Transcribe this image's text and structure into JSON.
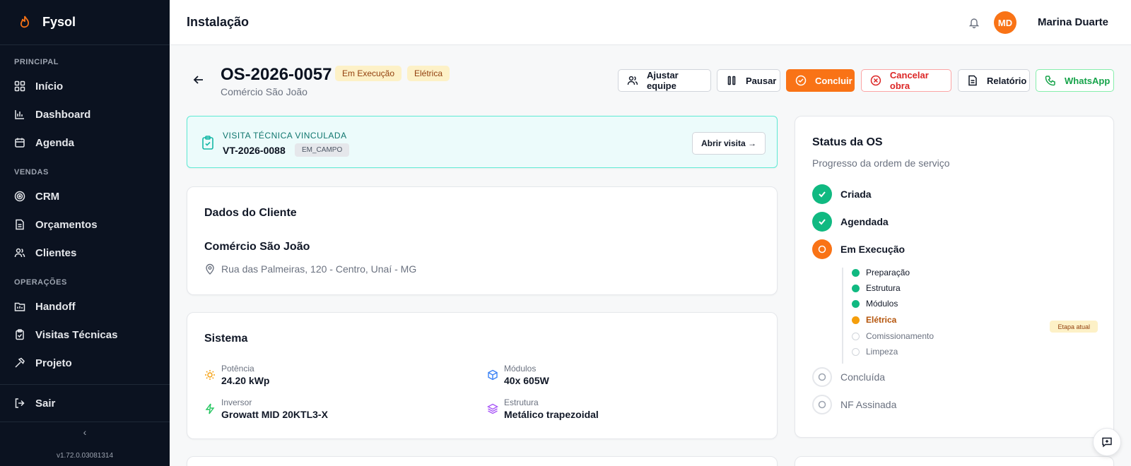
{
  "app": {
    "name": "Fysol",
    "version": "v1.72.0.03081314"
  },
  "sidebar": {
    "sections": [
      {
        "label": "PRINCIPAL",
        "items": [
          {
            "label": "Início",
            "icon": "grid-icon"
          },
          {
            "label": "Dashboard",
            "icon": "bar-chart-icon"
          },
          {
            "label": "Agenda",
            "icon": "calendar-icon"
          }
        ]
      },
      {
        "label": "VENDAS",
        "items": [
          {
            "label": "CRM",
            "icon": "target-icon"
          },
          {
            "label": "Orçamentos",
            "icon": "document-icon"
          },
          {
            "label": "Clientes",
            "icon": "users-icon"
          }
        ]
      },
      {
        "label": "OPERAÇÕES",
        "items": [
          {
            "label": "Handoff",
            "icon": "folder-icon"
          },
          {
            "label": "Visitas Técnicas",
            "icon": "clipboard-icon"
          },
          {
            "label": "Projeto",
            "icon": "hammer-icon"
          }
        ]
      }
    ],
    "logout": "Sair",
    "collapse_glyph": "‹"
  },
  "header": {
    "title": "Instalação",
    "user_initials": "MD",
    "user_name": "Marina Duarte"
  },
  "os": {
    "code": "OS-2026-0057",
    "badges": [
      "Em Execução",
      "Elétrica"
    ],
    "client": "Comércio São João",
    "actions": {
      "team": "Ajustar equipe",
      "pause": "Pausar",
      "finish": "Concluir",
      "cancel": "Cancelar obra",
      "report": "Relatório",
      "whatsapp": "WhatsApp"
    }
  },
  "visit": {
    "label": "VISITA TÉCNICA VINCULADA",
    "code": "VT-2026-0088",
    "status": "EM_CAMPO",
    "open_label": "Abrir visita →"
  },
  "client_card": {
    "title": "Dados do Cliente",
    "name": "Comércio São João",
    "address": "Rua das Palmeiras, 120 - Centro, Unaí - MG"
  },
  "system": {
    "title": "Sistema",
    "specs": [
      {
        "label": "Potência",
        "value": "24.20 kWp",
        "icon": "sun-icon",
        "color": "#f59e0b"
      },
      {
        "label": "Módulos",
        "value": "40x 605W",
        "icon": "cube-icon",
        "color": "#3b82f6"
      },
      {
        "label": "Inversor",
        "value": "Growatt MID 20KTL3-X",
        "icon": "bolt-icon",
        "color": "#22c55e"
      },
      {
        "label": "Estrutura",
        "value": "Metálico trapezoidal",
        "icon": "layers-icon",
        "color": "#a855f7"
      }
    ]
  },
  "status": {
    "title": "Status da OS",
    "subtitle": "Progresso da ordem de serviço",
    "steps": [
      {
        "label": "Criada",
        "state": "done"
      },
      {
        "label": "Agendada",
        "state": "done"
      },
      {
        "label": "Em Execução",
        "state": "current"
      },
      {
        "label": "Concluída",
        "state": "todo"
      },
      {
        "label": "NF Assinada",
        "state": "todo"
      }
    ],
    "substeps": [
      {
        "label": "Preparação",
        "state": "done"
      },
      {
        "label": "Estrutura",
        "state": "done"
      },
      {
        "label": "Módulos",
        "state": "done"
      },
      {
        "label": "Elétrica",
        "state": "current"
      },
      {
        "label": "Comissionamento",
        "state": "todo"
      },
      {
        "label": "Limpeza",
        "state": "todo"
      }
    ],
    "current_badge": "Etapa atual"
  },
  "colors": {
    "accent": "#f97316",
    "success": "#10b981",
    "sidebar_bg": "#0b1220",
    "teal": "#14b8a6"
  }
}
